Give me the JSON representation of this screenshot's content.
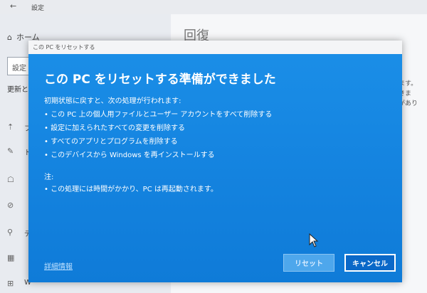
{
  "settings": {
    "window_title": "設定",
    "back_symbol": "←",
    "home_label": "ホーム",
    "search_placeholder": "設定",
    "section_label": "更新とセ",
    "left_items": [
      "フ",
      "ト",
      "",
      "",
      "デ",
      "",
      "W"
    ],
    "page_title": "回復",
    "right_fragments": [
      "ます。",
      "きま",
      "があり"
    ]
  },
  "dialog": {
    "title": "この PC をリセットする",
    "heading": "この PC をリセットする準備ができました",
    "intro": "初期状態に戻すと、次の処理が行われます:",
    "bullets": [
      "• この PC 上の個人用ファイルとユーザー アカウントをすべて削除する",
      "• 設定に加えられたすべての変更を削除する",
      "• すべてのアプリとプログラムを削除する",
      "• このデバイスから Windows を再インストールする"
    ],
    "note_label": "注:",
    "note_bullet": "• この処理には時間がかかり、PC は再起動されます。",
    "details_link": "詳細情報",
    "reset_button": "リセット",
    "cancel_button": "キャンセル"
  }
}
